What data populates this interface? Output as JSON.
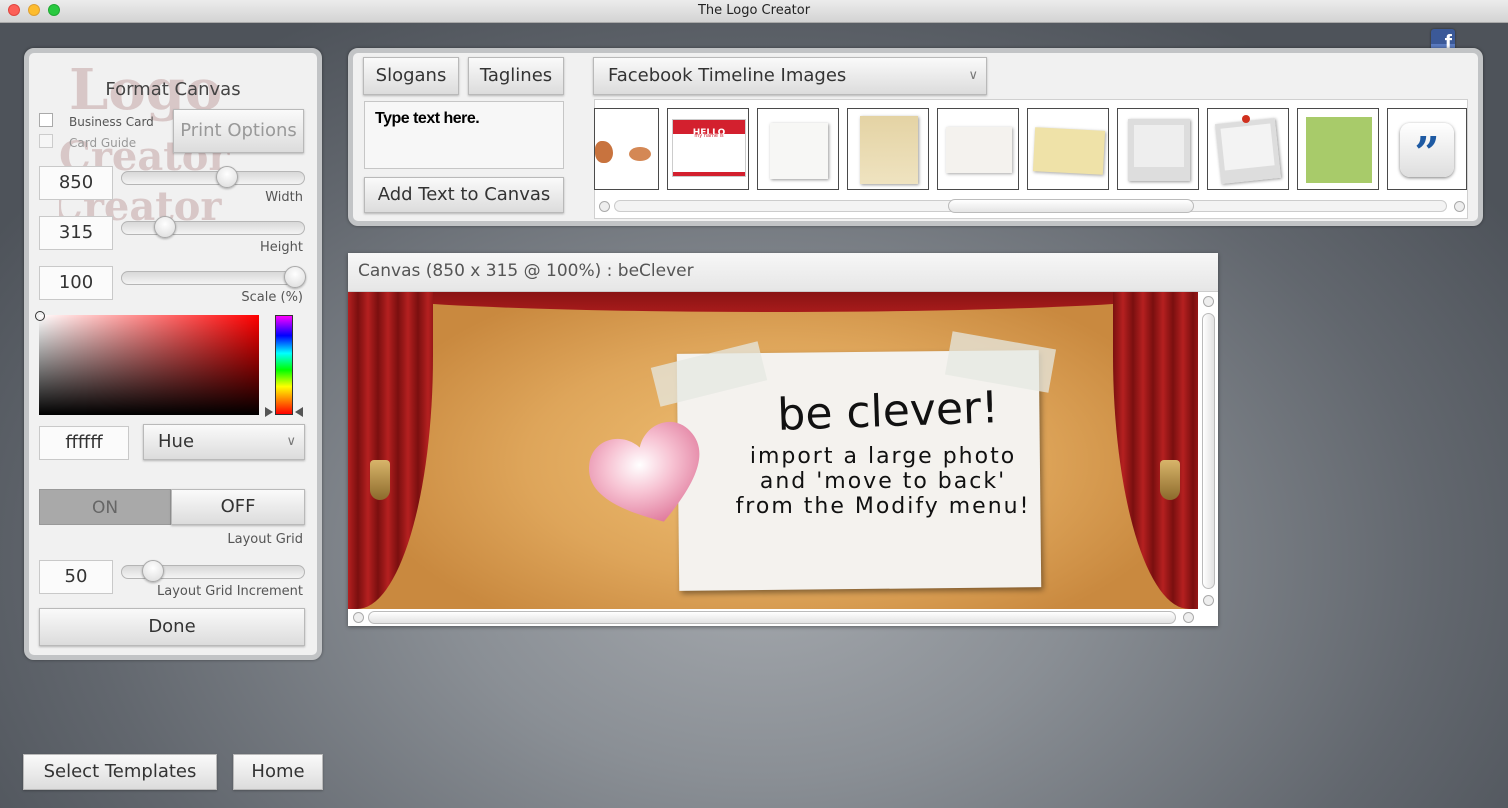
{
  "window": {
    "title": "The Logo Creator"
  },
  "format_canvas": {
    "title": "Format Canvas",
    "business_card_label": "Business Card",
    "card_guide_label": "Card Guide",
    "print_options_label": "Print Options",
    "width_value": "850",
    "width_label": "Width",
    "height_value": "315",
    "height_label": "Height",
    "scale_value": "100",
    "scale_label": "Scale (%)",
    "color_hex": "ffffff",
    "color_mode": "Hue",
    "grid_on_label": "ON",
    "grid_off_label": "OFF",
    "layout_grid_label": "Layout Grid",
    "grid_increment_value": "50",
    "grid_increment_label": "Layout Grid Increment",
    "done_label": "Done"
  },
  "text_tools": {
    "slogans_label": "Slogans",
    "taglines_label": "Taglines",
    "text_placeholder": "Type text here.",
    "add_text_label": "Add Text to Canvas",
    "category_selected": "Facebook Timeline Images",
    "thumbnails": [
      {
        "icon": "hands-sticker"
      },
      {
        "icon": "hello-name-tag",
        "text": "HELLO",
        "subtext": "my name is"
      },
      {
        "icon": "pinned-white-paper"
      },
      {
        "icon": "folded-tan-note"
      },
      {
        "icon": "taped-white-paper"
      },
      {
        "icon": "pinned-yellow-note"
      },
      {
        "icon": "polaroid-frame"
      },
      {
        "icon": "pinned-polaroid-frame"
      },
      {
        "icon": "green-sticky-note"
      },
      {
        "icon": "quote-button"
      }
    ]
  },
  "canvas": {
    "title": "Canvas (850 x 315 @ 100%) : beClever",
    "headline": "be clever!",
    "body_lines": [
      "import a large photo",
      "and 'move to back'",
      "from the Modify menu!"
    ]
  },
  "bottom": {
    "select_templates_label": "Select Templates",
    "home_label": "Home"
  },
  "facebook_icon": {
    "letter": "f",
    "color": "#3b5998"
  }
}
